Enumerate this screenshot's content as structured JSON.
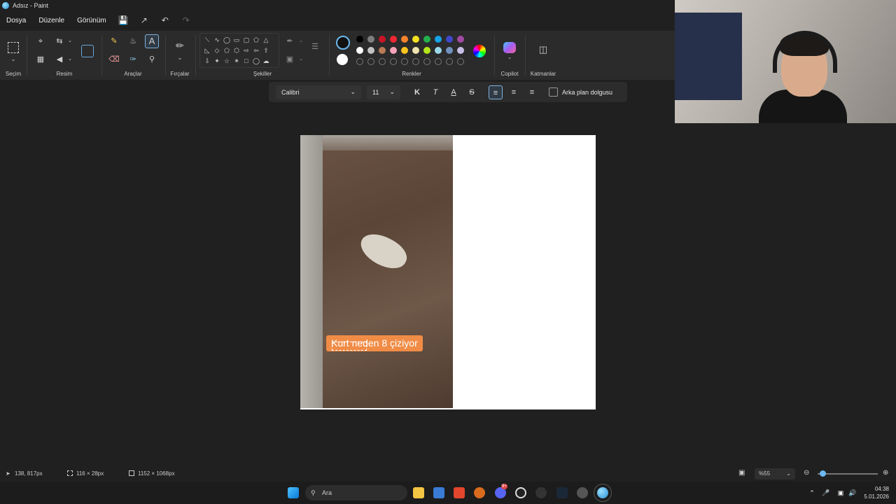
{
  "window": {
    "title": "Adsız - Paint"
  },
  "menu": [
    "Dosya",
    "Düzenle",
    "Görünüm"
  ],
  "ribbon": {
    "groups": {
      "selection": "Seçim",
      "image": "Resim",
      "tools": "Araçlar",
      "brushes": "Fırçalar",
      "shapes": "Şekiller",
      "colors": "Renkler",
      "copilot": "Copilot",
      "layers": "Katmanlar"
    },
    "palette": {
      "row1": [
        "#000000",
        "#7f7f7f",
        "#c81528",
        "#ee2833",
        "#f7832d",
        "#f4e01f",
        "#22b14c",
        "#16a3e8",
        "#3f48cc",
        "#a349a4"
      ],
      "row2": [
        "#ffffff",
        "#c3c3c3",
        "#b97a56",
        "#f4a3b8",
        "#f8c41f",
        "#efe4b0",
        "#b5e61d",
        "#99d9ea",
        "#7092be",
        "#c8bfe7"
      ]
    }
  },
  "textbar": {
    "font": "Calibri",
    "size": "11",
    "bold": "K",
    "italic": "T",
    "underline": "A",
    "strike": "S",
    "bg_fill_label": "Arka plan dolgusu"
  },
  "canvas": {
    "caption": "Kurt neden 8 çiziyor"
  },
  "status": {
    "cursor": "138, 817px",
    "selection": "116 × 28px",
    "canvas_size": "1152 × 1068px",
    "zoom": "%55",
    "zoom_fraction": 0.08
  },
  "taskbar": {
    "search_placeholder": "Ara",
    "time": "04:38",
    "date": "5.01.2026",
    "discord_badge": "9+"
  }
}
